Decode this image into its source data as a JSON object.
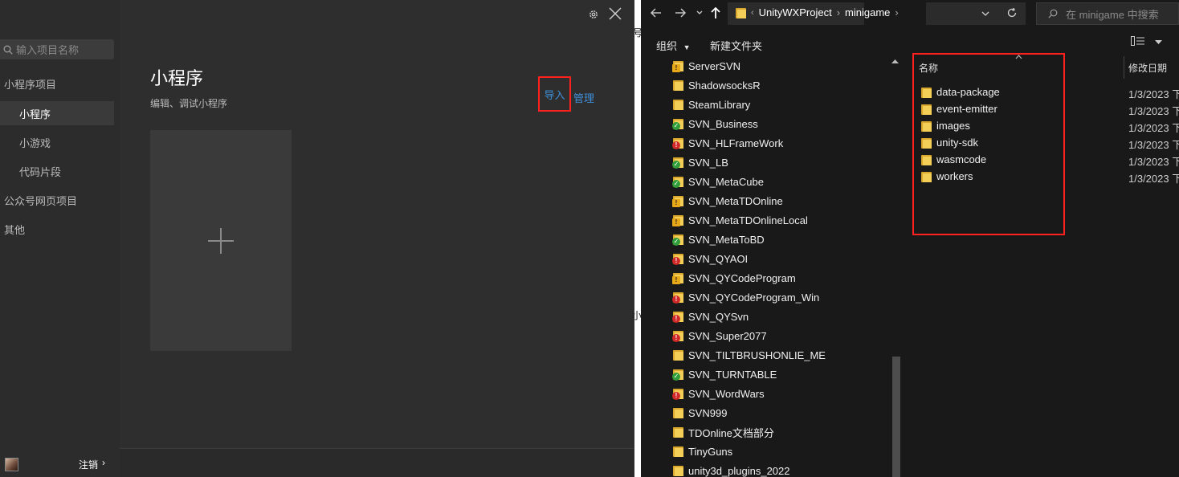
{
  "wechat_devtools": {
    "search_placeholder": "输入项目名称",
    "nav": {
      "miniprogram_projects": "小程序项目",
      "miniprogram": "小程序",
      "minigame": "小游戏",
      "code_snippets": "代码片段",
      "official_web": "公众号网页项目",
      "other": "其他"
    },
    "title": "小程序",
    "subtitle": "编辑、调试小程序",
    "import_label": "导入",
    "manage_label": "管理",
    "add_symbol": "+",
    "logout_label": "注销",
    "logout_arrow": "›"
  },
  "stray_glyphs": {
    "top": "号",
    "mid": "小"
  },
  "explorer": {
    "breadcrumb_sep": "›",
    "breadcrumb": [
      "UnityWXProject",
      "minigame"
    ],
    "search_placeholder": "在 minigame 中搜索",
    "organize_label": "组织",
    "new_folder_label": "新建文件夹",
    "columns": {
      "name": "名称",
      "date_modified": "修改日期"
    },
    "tree": [
      {
        "name": "ServerSVN",
        "status": "warn"
      },
      {
        "name": "ShadowsocksR",
        "status": "none"
      },
      {
        "name": "SteamLibrary",
        "status": "none"
      },
      {
        "name": "SVN_Business",
        "status": "ok"
      },
      {
        "name": "SVN_HLFrameWork",
        "status": "err"
      },
      {
        "name": "SVN_LB",
        "status": "ok"
      },
      {
        "name": "SVN_MetaCube",
        "status": "ok"
      },
      {
        "name": "SVN_MetaTDOnline",
        "status": "warn"
      },
      {
        "name": "SVN_MetaTDOnlineLocal",
        "status": "warn"
      },
      {
        "name": "SVN_MetaToBD",
        "status": "ok"
      },
      {
        "name": "SVN_QYAOI",
        "status": "err"
      },
      {
        "name": "SVN_QYCodeProgram",
        "status": "warn"
      },
      {
        "name": "SVN_QYCodeProgram_Win",
        "status": "err"
      },
      {
        "name": "SVN_QYSvn",
        "status": "err"
      },
      {
        "name": "SVN_Super2077",
        "status": "err"
      },
      {
        "name": "SVN_TILTBRUSHONLIE_ME",
        "status": "none"
      },
      {
        "name": "SVN_TURNTABLE",
        "status": "ok"
      },
      {
        "name": "SVN_WordWars",
        "status": "err"
      },
      {
        "name": "SVN999",
        "status": "none"
      },
      {
        "name": "TDOnline文档部分",
        "status": "none"
      },
      {
        "name": "TinyGuns",
        "status": "none"
      },
      {
        "name": "unity3d_plugins_2022",
        "status": "none"
      }
    ],
    "files": [
      {
        "name": "data-package",
        "date": "1/3/2023 下"
      },
      {
        "name": "event-emitter",
        "date": "1/3/2023 下"
      },
      {
        "name": "images",
        "date": "1/3/2023 下"
      },
      {
        "name": "unity-sdk",
        "date": "1/3/2023 下"
      },
      {
        "name": "wasmcode",
        "date": "1/3/2023 下"
      },
      {
        "name": "workers",
        "date": "1/3/2023 下"
      }
    ]
  },
  "colors": {
    "highlight": "#ff2020",
    "link": "#3f8fd8",
    "folder": "#f4cf58"
  }
}
